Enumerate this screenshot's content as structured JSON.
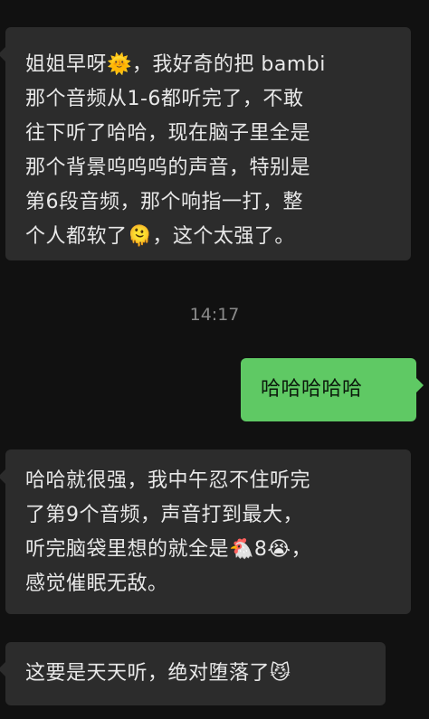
{
  "colors": {
    "background": "#111111",
    "incoming_bubble": "#2c2c2c",
    "outgoing_bubble": "#5fc964",
    "timestamp_text": "#8a8a8a"
  },
  "messages": [
    {
      "sender": "other",
      "lines": [
        "姐姐早呀🌞，我好奇的把 bambi",
        "那个音频从1-6都听完了，不敢",
        "往下听了哈哈，现在脑子里全是",
        "那个背景呜呜呜的声音，特别是",
        "第6段音频，那个响指一打，整",
        "个人都软了🫠，这个太强了。"
      ]
    },
    {
      "sender": "timestamp",
      "text": "14:17"
    },
    {
      "sender": "me",
      "lines": [
        "哈哈哈哈哈"
      ]
    },
    {
      "sender": "other",
      "lines": [
        "哈哈就很强，我中午忍不住听完",
        "了第9个音频，声音打到最大，",
        "听完脑袋里想的就全是🐔8😭，",
        "感觉催眠无敌。"
      ]
    },
    {
      "sender": "other",
      "lines": [
        "这要是天天听，绝对堕落了😼"
      ]
    }
  ]
}
